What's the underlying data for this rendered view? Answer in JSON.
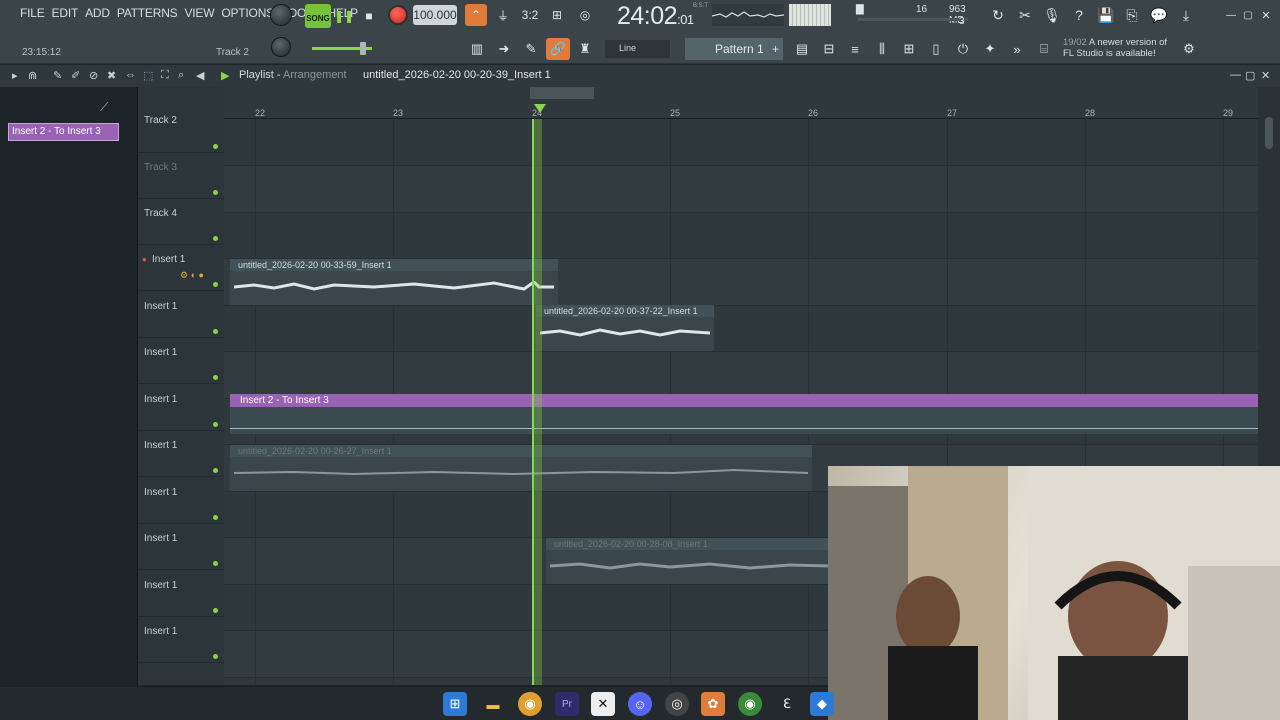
{
  "menu": [
    "FILE",
    "EDIT",
    "ADD",
    "PATTERNS",
    "VIEW",
    "OPTIONS",
    "TOOLS",
    "HELP"
  ],
  "transport": {
    "mode": "SONG",
    "tempo": "100.000",
    "time_main": "24:02",
    "time_sub": "01",
    "time_label": "B:S:T"
  },
  "hint": {
    "time": "23:15:12",
    "track": "Track 2"
  },
  "cpu": {
    "voices": "16",
    "memory": "963 MB",
    "polyphony": "3"
  },
  "snap_mode": "Line",
  "pattern": "Pattern 1",
  "update_notice": {
    "date": "19/02",
    "line1": "A newer version of",
    "line2": "FL Studio is available!"
  },
  "playlist": {
    "title": "Playlist",
    "subtitle": "Arrangement",
    "file": "untitled_2026-02-20 00-20-39_Insert 1"
  },
  "picker": {
    "selected": "Insert 2 - To Insert 3"
  },
  "timeline": [
    "22",
    "23",
    "24",
    "25",
    "26",
    "27",
    "28",
    "29"
  ],
  "tracks": [
    {
      "name": "Track 2",
      "dim": false
    },
    {
      "name": "Track 3",
      "dim": true
    },
    {
      "name": "Track 4",
      "dim": false
    },
    {
      "name": "Insert 1",
      "dim": false
    },
    {
      "name": "Insert 1",
      "dim": false
    },
    {
      "name": "Insert 1",
      "dim": false
    },
    {
      "name": "Insert 1",
      "dim": false
    },
    {
      "name": "Insert 1",
      "dim": false
    },
    {
      "name": "Insert 1",
      "dim": false
    },
    {
      "name": "Insert 1",
      "dim": false
    },
    {
      "name": "Insert 1",
      "dim": false
    },
    {
      "name": "Insert 1",
      "dim": false
    }
  ],
  "clips": {
    "c1": "untitled_2026-02-20 00-33-59_Insert 1",
    "c2": "untitled_2026-02-20 00-37-22_Insert 1",
    "c3": "untitled_2026-02-20 00-26-27_Insert 1",
    "c4": "untitled_2026-02-20 00-28-08_Insert 1",
    "automation": "Insert 2 - To Insert 3"
  },
  "icons": {
    "record": "record-icon",
    "stop": "stop-icon",
    "pause": "pause-icon"
  },
  "colors": {
    "accent_green": "#8bd64a",
    "automation_purple": "#9a62b4",
    "record_red": "#d83a2f",
    "active_orange": "#e07b3a"
  }
}
